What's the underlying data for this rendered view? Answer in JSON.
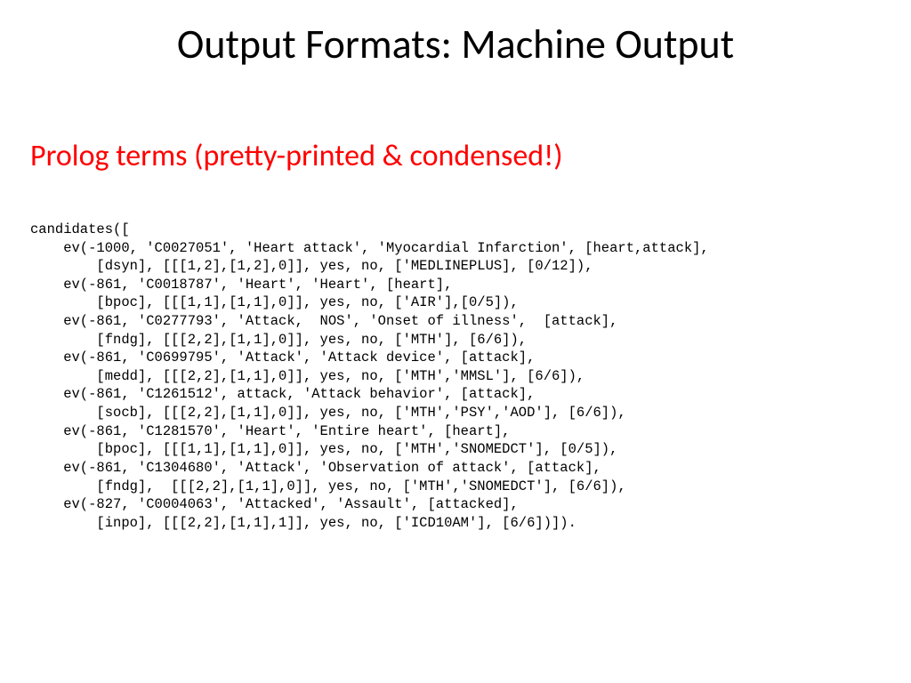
{
  "title": "Output Formats: Machine Output",
  "subtitle": "Prolog terms (pretty-printed & condensed!)",
  "code": "candidates([\n    ev(-1000, 'C0027051', 'Heart attack', 'Myocardial Infarction', [heart,attack],\n        [dsyn], [[[1,2],[1,2],0]], yes, no, ['MEDLINEPLUS], [0/12]),\n    ev(-861, 'C0018787', 'Heart', 'Heart', [heart],\n        [bpoc], [[[1,1],[1,1],0]], yes, no, ['AIR'],[0/5]),\n    ev(-861, 'C0277793', 'Attack,  NOS', 'Onset of illness',  [attack],\n        [fndg], [[[2,2],[1,1],0]], yes, no, ['MTH'], [6/6]),\n    ev(-861, 'C0699795', 'Attack', 'Attack device', [attack],\n        [medd], [[[2,2],[1,1],0]], yes, no, ['MTH','MMSL'], [6/6]),\n    ev(-861, 'C1261512', attack, 'Attack behavior', [attack],\n        [socb], [[[2,2],[1,1],0]], yes, no, ['MTH','PSY','AOD'], [6/6]),\n    ev(-861, 'C1281570', 'Heart', 'Entire heart', [heart],\n        [bpoc], [[[1,1],[1,1],0]], yes, no, ['MTH','SNOMEDCT'], [0/5]),\n    ev(-861, 'C1304680', 'Attack', 'Observation of attack', [attack],\n        [fndg],  [[[2,2],[1,1],0]], yes, no, ['MTH','SNOMEDCT'], [6/6]),\n    ev(-827, 'C0004063', 'Attacked', 'Assault', [attacked],\n        [inpo], [[[2,2],[1,1],1]], yes, no, ['ICD10AM'], [6/6])])."
}
